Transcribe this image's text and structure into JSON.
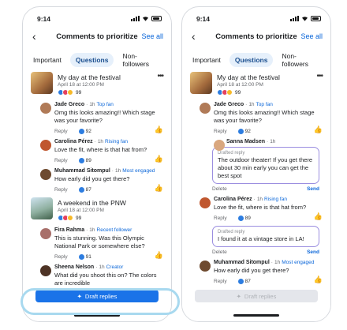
{
  "status_time": "9:14",
  "header": {
    "title": "Comments to prioritize",
    "see_all": "See all"
  },
  "tabs": [
    "Important",
    "Questions",
    "Non-followers"
  ],
  "post1": {
    "title": "My day at the festival",
    "date": "April 18 at 12:00 PM",
    "count": "99"
  },
  "post2": {
    "title": "A weekend in the PNW",
    "date": "April 18 at 12:00 PM",
    "count": "99"
  },
  "labels": {
    "reply": "Reply",
    "delete": "Delete",
    "send": "Send",
    "drafted_reply": "Drafted reply",
    "draft_button": "Draft replies"
  },
  "comments": {
    "jade": {
      "name": "Jade Greco",
      "time": "1h",
      "badge": "Top fan",
      "text": "Omg this looks amazing!! Which stage was your favorite?",
      "likes": "92"
    },
    "carolina": {
      "name": "Carolina Pérez",
      "time": "1h",
      "badge": "Rising fan",
      "text": "Love the fit, where is that hat from?",
      "likes": "89"
    },
    "muhammad": {
      "name": "Muhammad Sitompul",
      "time": "1h",
      "badge": "Most engaged",
      "text": "How early did you get there?",
      "likes": "87"
    },
    "fira": {
      "name": "Fira Rahma",
      "time": "1h",
      "badge": "Recent follower",
      "text": "This is stunning. Was this Olympic National Park or somewhere else?",
      "likes": "91"
    },
    "sheena": {
      "name": "Sheena Nelson",
      "time": "1h",
      "badge": "Creator",
      "text": "What did you shoot this on? The colors are incredible"
    },
    "sanna": {
      "name": "Sanna Madsen",
      "time": "1h"
    }
  },
  "drafts": {
    "sanna": "The outdoor theater! If you get there about 30 min early you can get the best spot",
    "carolina": "I found it at a vintage store in LA!"
  },
  "colors": {
    "accent": "#1a73e8",
    "draft_border": "#9b8ee0",
    "highlight": "#a8d9ef"
  }
}
